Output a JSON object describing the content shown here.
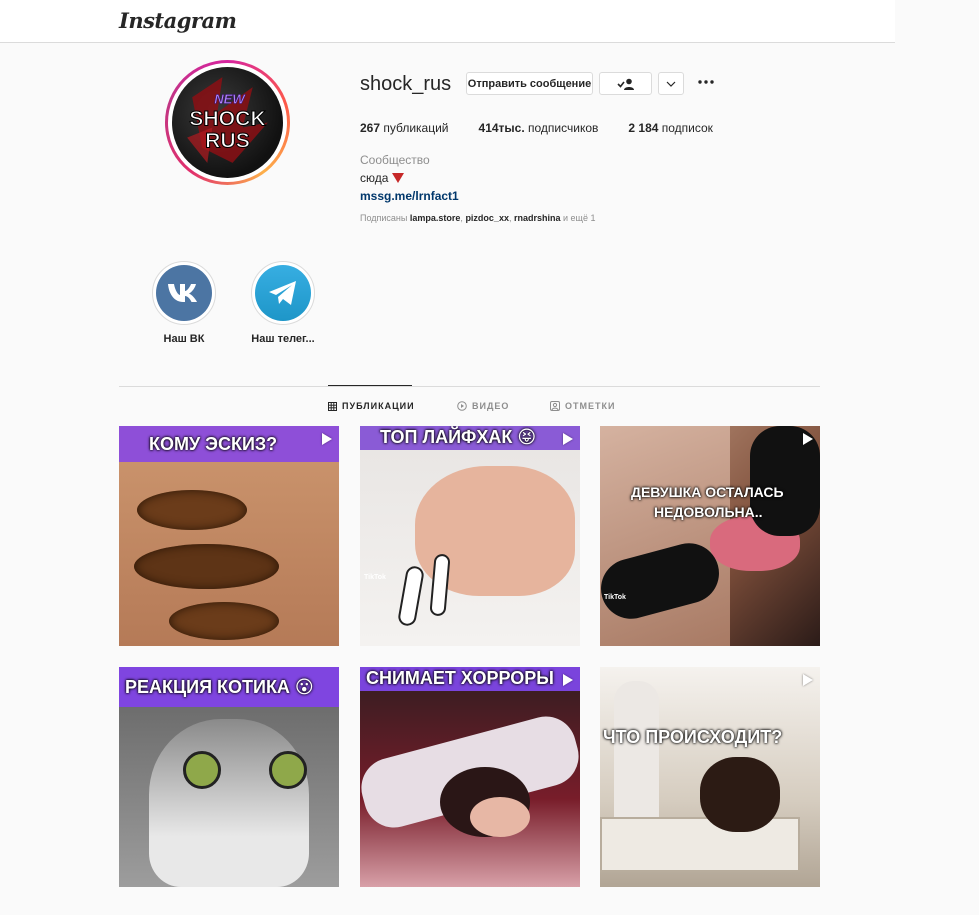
{
  "app": {
    "logo": "Instagram"
  },
  "profile": {
    "username": "shock_rus",
    "avatar_text": [
      "NEW",
      "SHOCK",
      "RUS"
    ],
    "buttons": {
      "message": "Отправить сообщение"
    },
    "stats": {
      "posts_count": "267",
      "posts_label": "публикаций",
      "followers_count": "414тыс.",
      "followers_label": "подписчиков",
      "following_count": "2 184",
      "following_label": "подписок"
    },
    "category": "Сообщество",
    "bio": "сюда",
    "link": "mssg.me/lrnfact1",
    "followed_by": {
      "prefix": "Подписаны",
      "users": [
        "lampa.store",
        "pizdoc_xx",
        "rnadrshina"
      ],
      "suffix": "и ещё 1"
    }
  },
  "highlights": [
    {
      "label": "Наш ВК",
      "icon": "vk-icon"
    },
    {
      "label": "Наш телег...",
      "icon": "telegram-icon"
    }
  ],
  "tabs": [
    {
      "label": "ПУБЛИКАЦИИ",
      "icon": "grid-icon",
      "active": true
    },
    {
      "label": "ВИДЕО",
      "icon": "play-circle-icon",
      "active": false
    },
    {
      "label": "ОТМЕТКИ",
      "icon": "tag-icon",
      "active": false
    }
  ],
  "posts": [
    {
      "caption": "КОМУ ЭСКИЗ?"
    },
    {
      "caption": "ТОП ЛАЙФХАК 😝",
      "watermark": "TikTok"
    },
    {
      "caption_line1": "ДЕВУШКА ОСТАЛАСЬ",
      "caption_line2": "НЕДОВОЛЬНА..",
      "watermark": "TikTok"
    },
    {
      "caption": "РЕАКЦИЯ КОТИКА 😮"
    },
    {
      "caption": "СНИМАЕТ ХОРРОРЫ"
    },
    {
      "caption": "ЧТО ПРОИСХОДИТ?"
    }
  ]
}
